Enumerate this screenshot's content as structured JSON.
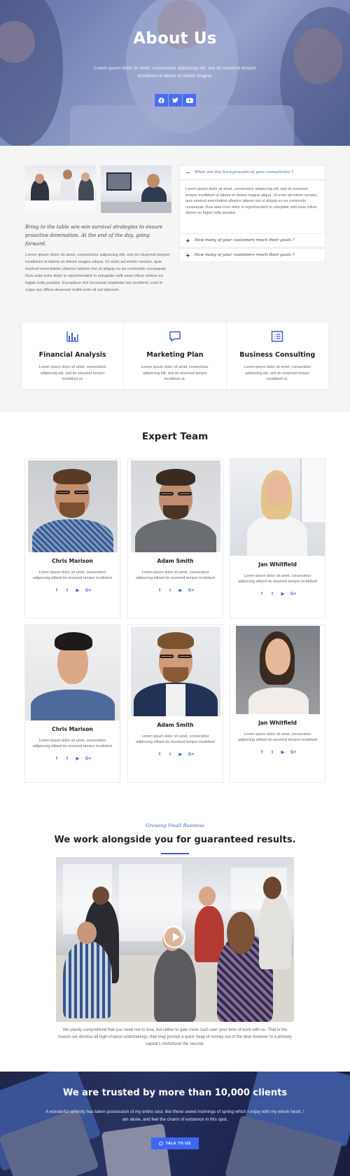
{
  "hero": {
    "title": "About Us",
    "text": "Lorem ipsum dolor sit amet, consectetur adipiscing elit, sed do eiusmod tempor incididunt ut labore et dolore magna.",
    "socials": [
      "facebook-icon",
      "twitter-icon",
      "youtube-icon"
    ]
  },
  "about": {
    "lead": "Bring to the table win-win survival strategies to ensure proactive domination. At the end of the day, going forward.",
    "body": "Lorem ipsum dolor sit amet, consectetur adipiscing elit, sed do eiusmod tempor incididunt ut labore et dolore magna aliqua. Ut enim ad minim veniam, quis nostrud exercitation ullamco laboris nisi ut aliquip ex ea commodo consequat. Duis aute irure dolor in reprehenderit in voluptate velit esse cillum dolore eu fugiat nulla pariatur. Excepteur sint occaecat cupidatat non proident, sunt in culpa qui officia deserunt mollit anim id est laborum.",
    "accordion": [
      {
        "sign": "−",
        "question": "What are the backgrounds of your consultants ?",
        "answer": "Lorem ipsum dolor sit amet, consectetur adipiscing elit, sed do eiusmod tempor incididunt ut labore et dolore magna aliqua. Ut enim ad minim veniam, quis nostrud exercitation ullamco laboris nisi ut aliquip ex ea commodo consequat. Duis aute irure dolor in reprehenderit in voluptate velit esse cillum dolore eu fugiat nulla pariatur."
      },
      {
        "sign": "+",
        "question": "How many of your customers reach their goals ?"
      },
      {
        "sign": "+",
        "question": "How many of your customers reach their goals ?"
      }
    ]
  },
  "features": [
    {
      "icon": "bar-chart-icon",
      "title": "Financial Analysis",
      "text": "Lorem ipsum dolor sit amet, consectetur adipiscing elit, sed do eiusmod tempor incididunt ut."
    },
    {
      "icon": "chat-bubble-icon",
      "title": "Marketing Plan",
      "text": "Lorem ipsum dolor sit amet, consectetur adipiscing elit, sed do eiusmod tempor incididunt ut."
    },
    {
      "icon": "list-box-icon",
      "title": "Business Consulting",
      "text": "Lorem ipsum dolor sit amet, consectetur adipiscing elit, sed do eiusmod tempor incididunt ut."
    }
  ],
  "team": {
    "title": "Expert Team",
    "members": [
      {
        "name": "Chris Marison",
        "text": "Lorem ipsum dolor sit amet, consectetur adipiscing elitsed do eiusmod tempor incididunt"
      },
      {
        "name": "Adam Smith",
        "text": "Lorem ipsum dolor sit amet, consectetur adipiscing elitsed do eiusmod tempor incididunt"
      },
      {
        "name": "Jan Whitfield",
        "text": "Lorem ipsum dolor sit amet, consectetur adipiscing elitsed do eiusmod tempor incididunt"
      },
      {
        "name": "Chris Marison",
        "text": "Lorem ipsum dolor sit amet, consectetur adipiscing elitsed do eiusmod tempor incididunt"
      },
      {
        "name": "Adam Smith",
        "text": "Lorem ipsum dolor sit amet, consectetur adipiscing elitsed do eiusmod tempor incididunt"
      },
      {
        "name": "Jan Whitfield",
        "text": "Lorem ipsum dolor sit amet, consectetur adipiscing elitsed do eiusmod tempor incididunt"
      }
    ],
    "social_labels": [
      "f",
      "t",
      "▶",
      "G+"
    ]
  },
  "growing": {
    "subtitle": "Growing Small Business",
    "title": "We work alongside you for guaranteed results.",
    "text": "We plainly comprehend that you need not to lose, but rather to gain more cash over your time of work with us. That is the reason we dismiss all high-chance undertakings, that may prompt a quick heap of money out of the blue however to a primary capital's misfortune the second."
  },
  "trust": {
    "title": "We are trusted by more than 10,000 clients",
    "text": "A wonderful serenity has taken possession of my entire soul, like these sweet mornings of spring which I enjoy with my whole heart. I am alone, and feel the charm of existence in this spot.",
    "button": "TALK TO US"
  },
  "colors": {
    "accent": "#3d5fd6",
    "button": "#3d66f2"
  }
}
